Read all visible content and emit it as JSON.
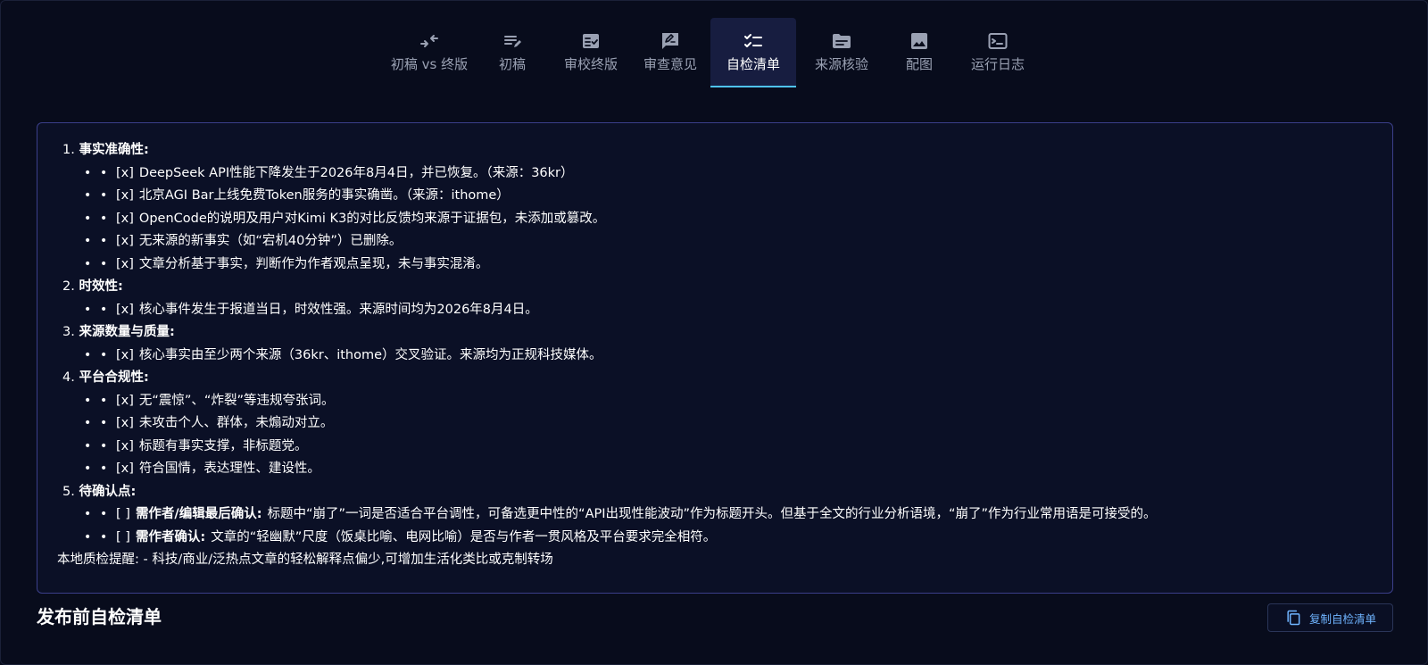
{
  "tabs": [
    {
      "label": "初稿 vs 终版",
      "icon": "compare-arrows-icon",
      "active": false
    },
    {
      "label": "初稿",
      "icon": "edit-lines-icon",
      "active": false
    },
    {
      "label": "审校终版",
      "icon": "fact-check-icon",
      "active": false
    },
    {
      "label": "审查意见",
      "icon": "rate-review-icon",
      "active": false
    },
    {
      "label": "自检清单",
      "icon": "checklist-icon",
      "active": true
    },
    {
      "label": "来源核验",
      "icon": "source-doc-icon",
      "active": false
    },
    {
      "label": "配图",
      "icon": "image-icon",
      "active": false
    },
    {
      "label": "运行日志",
      "icon": "terminal-icon",
      "active": false
    }
  ],
  "checklist": {
    "sections": [
      {
        "num": "1.",
        "title": "事实准确性:",
        "items": [
          {
            "mark": "[x]",
            "text": "DeepSeek API性能下降发生于2026年8月4日，并已恢复。（来源：36kr）"
          },
          {
            "mark": "[x]",
            "text": "北京AGI Bar上线免费Token服务的事实确凿。（来源：ithome）"
          },
          {
            "mark": "[x]",
            "text": "OpenCode的说明及用户对Kimi K3的对比反馈均来源于证据包，未添加或篡改。"
          },
          {
            "mark": "[x]",
            "text": "无来源的新事实（如“宕机40分钟”）已删除。"
          },
          {
            "mark": "[x]",
            "text": "文章分析基于事实，判断作为作者观点呈现，未与事实混淆。"
          }
        ]
      },
      {
        "num": "2.",
        "title": "时效性:",
        "items": [
          {
            "mark": "[x]",
            "text": "核心事件发生于报道当日，时效性强。来源时间均为2026年8月4日。"
          }
        ]
      },
      {
        "num": "3.",
        "title": "来源数量与质量:",
        "items": [
          {
            "mark": "[x]",
            "text": "核心事实由至少两个来源（36kr、ithome）交叉验证。来源均为正规科技媒体。"
          }
        ]
      },
      {
        "num": "4.",
        "title": "平台合规性:",
        "items": [
          {
            "mark": "[x]",
            "text": "无“震惊”、“炸裂”等违规夸张词。"
          },
          {
            "mark": "[x]",
            "text": "未攻击个人、群体，未煽动对立。"
          },
          {
            "mark": "[x]",
            "text": "标题有事实支撑，非标题党。"
          },
          {
            "mark": "[x]",
            "text": "符合国情，表达理性、建设性。"
          }
        ]
      },
      {
        "num": "5.",
        "title": "待确认点:",
        "items": [
          {
            "mark": "[ ]",
            "strong": "需作者/编辑最后确认:",
            "text": "标题中“崩了”一词是否适合平台调性，可备选更中性的“API出现性能波动”作为标题开头。但基于全文的行业分析语境，“崩了”作为行业常用语是可接受的。"
          },
          {
            "mark": "[ ]",
            "strong": "需作者确认:",
            "text": "文章的“轻幽默”尺度（饭桌比喻、电网比喻）是否与作者一贯风格及平台要求完全相符。"
          }
        ]
      }
    ],
    "note": "本地质检提醒: - 科技/商业/泛热点文章的轻松解释点偏少,可增加生活化类比或克制转场"
  },
  "footer": {
    "title": "发布前自检清单",
    "copy_label": "复制自检清单",
    "copy_icon": "copy-icon"
  },
  "colors": {
    "background": "#080c1c",
    "panel_border": "#3b3f8a",
    "active_tab_bg": "#171d40",
    "active_tab_underline": "#4fc3f7",
    "link_blue": "#6fb4ff",
    "muted_text": "#9aa1b3"
  }
}
